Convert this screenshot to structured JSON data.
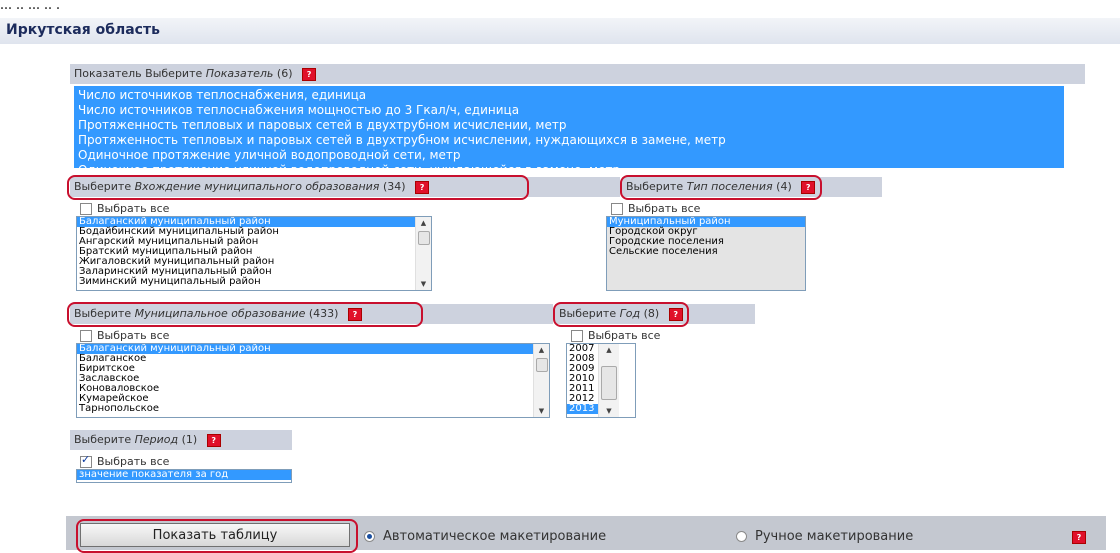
{
  "top_text": "...  ..  ...   .. .",
  "region": {
    "title": "Иркутская область"
  },
  "indicator": {
    "header_prefix": "Показатель Выберите ",
    "header_italic": "Показатель",
    "header_count": "(6)",
    "items": [
      "Число источников теплоснабжения, единица",
      "Число источников теплоснабжения мощностью до 3 Гкал/ч, единица",
      "Протяженность тепловых и паровых сетей в двухтрубном исчислении, метр",
      "Протяженность тепловых и паровых сетей в двухтрубном исчислении, нуждающихся в замене, метр",
      "Одиночное протяжение уличной водопроводной сети, метр",
      "Одиночное протяжение уличной водопроводной сети, нуждающейся в замене, метр"
    ]
  },
  "help_icon": "question-mark-icon",
  "select_all_label": "Выбрать все",
  "inclusion": {
    "header_prefix": "Выберите ",
    "header_italic": "Вхождение муниципального образования",
    "header_count": "(34)",
    "select_all_checked": false,
    "items": [
      "Балаганский муниципальный район",
      "Бодайбинский муниципальный район",
      "Ангарский муниципальный район",
      "Братский муниципальный район",
      "Жигаловский муниципальный район",
      "Заларинский муниципальный район",
      "Зиминский муниципальный район"
    ],
    "selected": "Балаганский муниципальный район"
  },
  "settlement_type": {
    "header_prefix": "Выберите ",
    "header_italic": "Тип поселения",
    "header_count": "(4)",
    "select_all_checked": false,
    "items": [
      "Муниципальный район",
      "Городской округ",
      "Городские поселения",
      "Сельские поселения"
    ],
    "selected": "Муниципальный район"
  },
  "municipality": {
    "header_prefix": "Выберите ",
    "header_italic": "Муниципальное образование",
    "header_count": "(433)",
    "select_all_checked": false,
    "items": [
      "Балаганский муниципальный район",
      "Балаганское",
      "Биритское",
      "Заславское",
      "Коноваловское",
      "Кумарейское",
      "Тарнопольское"
    ],
    "selected": "Балаганский муниципальный район"
  },
  "year": {
    "header_prefix": "Выберите ",
    "header_italic": "Год",
    "header_count": "(8)",
    "select_all_checked": false,
    "items": [
      "2007",
      "2008",
      "2009",
      "2010",
      "2011",
      "2012",
      "2013"
    ],
    "selected": "2013"
  },
  "period": {
    "header_prefix": "Выберите ",
    "header_italic": "Период",
    "header_count": "(1)",
    "select_all_checked": true,
    "items": [
      "значение показателя за год"
    ],
    "selected": "значение показателя за год"
  },
  "footer": {
    "show_table_button": "Показать таблицу",
    "radio_auto": "Автоматическое макетирование",
    "radio_manual": "Ручное макетирование",
    "auto_selected": true
  },
  "colors": {
    "selection": "#3399ff",
    "header_bg": "#cdd2de",
    "highlight_ring": "#c8102e",
    "help_icon": "#e0102a"
  }
}
